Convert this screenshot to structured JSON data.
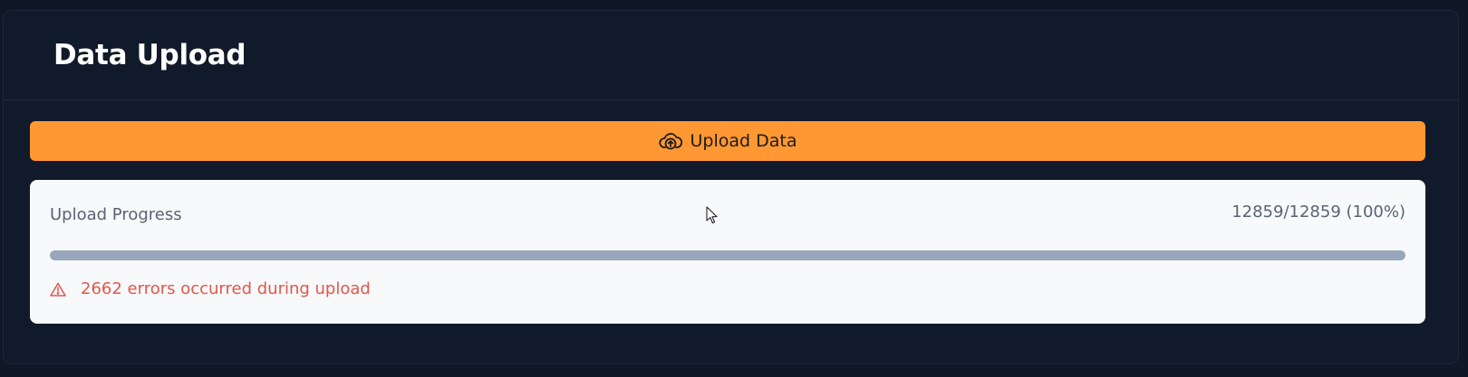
{
  "header": {
    "title": "Data Upload"
  },
  "upload_button": {
    "label": "Upload Data",
    "icon": "cloud-upload-icon",
    "background": "#ff9833"
  },
  "progress": {
    "label": "Upload Progress",
    "count_text": "12859/12859 (100%)",
    "completed": 12859,
    "total": 12859,
    "fraction": 1.0,
    "bar_color": "#97a6bb"
  },
  "errors": {
    "icon": "warning-triangle-icon",
    "message": "2662 errors occurred during upload",
    "color": "#e0584b"
  }
}
